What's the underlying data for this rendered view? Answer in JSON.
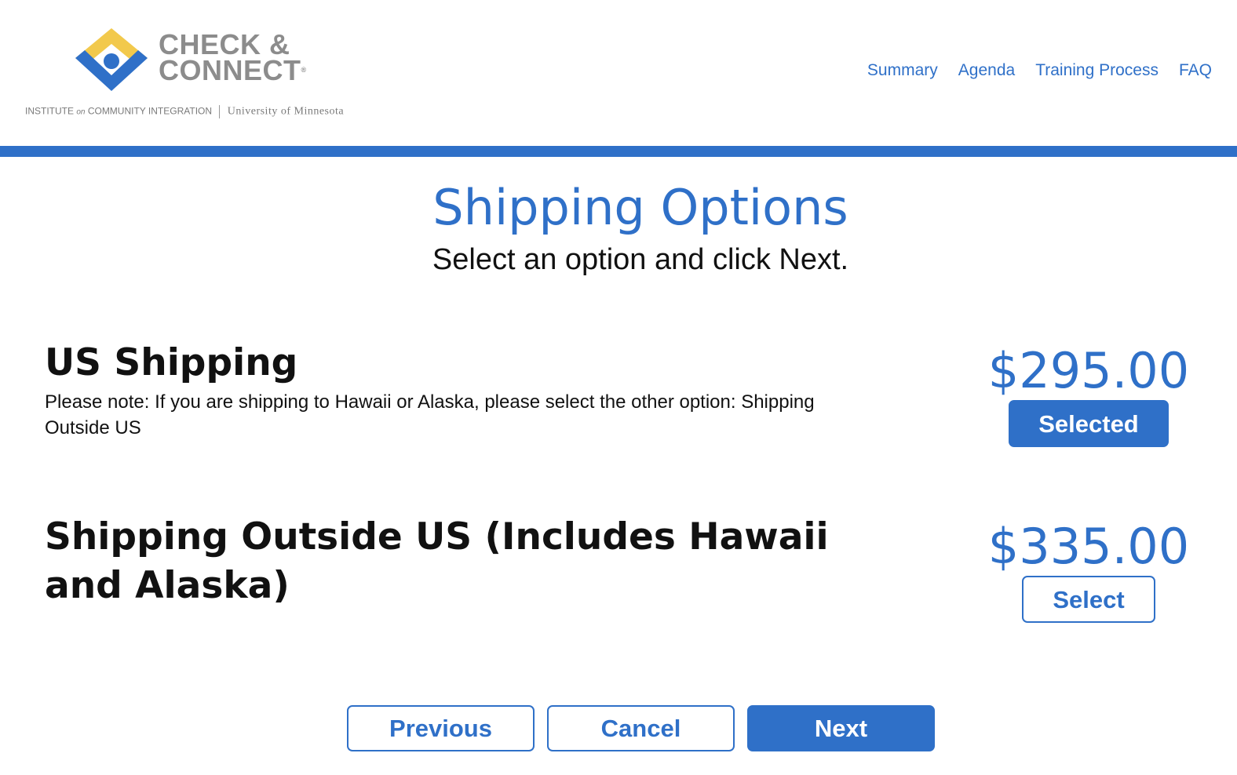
{
  "header": {
    "logo": {
      "line1": "CHECK &",
      "line2": "CONNECT",
      "reg_mark": "®",
      "sub_left_1": "INSTITUTE",
      "sub_left_on": "on",
      "sub_left_2": "COMMUNITY INTEGRATION",
      "sub_right": "University of Minnesota",
      "colors": {
        "yellow": "#f2c94c",
        "blue": "#2f70c8",
        "gray": "#8c8c8c"
      }
    },
    "nav": [
      {
        "label": "Summary"
      },
      {
        "label": "Agenda"
      },
      {
        "label": "Training Process"
      },
      {
        "label": "FAQ"
      }
    ]
  },
  "accent_color": "#2f70c8",
  "page": {
    "title": "Shipping Options",
    "subtitle": "Select an option and click Next."
  },
  "options": [
    {
      "name": "US Shipping",
      "note": "Please note: If you are shipping to Hawaii or Alaska, please select the other option: Shipping Outside US",
      "price": "$295.00",
      "button_label": "Selected",
      "selected": true
    },
    {
      "name": "Shipping Outside US (Includes Hawaii and Alaska)",
      "note": "",
      "price": "$335.00",
      "button_label": "Select",
      "selected": false
    }
  ],
  "footer": {
    "previous_label": "Previous",
    "cancel_label": "Cancel",
    "next_label": "Next"
  }
}
